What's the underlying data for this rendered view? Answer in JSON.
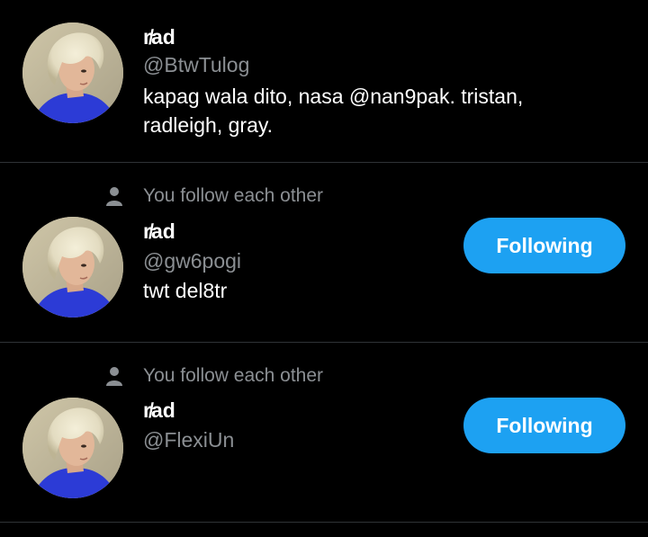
{
  "accent_color": "#1da1f2",
  "users": [
    {
      "name": "r̸ad",
      "handle": "@BtwTulog",
      "bio": "kapag wala dito, nasa @nan9pak. tristan, radleigh, gray.",
      "social_context": "",
      "button_label": ""
    },
    {
      "name": "r̸ad",
      "handle": "@gw6pogi",
      "bio": "twt del8tr",
      "social_context": "You follow each other",
      "button_label": "Following"
    },
    {
      "name": "r̸ad",
      "handle": "@FlexiUn",
      "bio": "",
      "social_context": "You follow each other",
      "button_label": "Following"
    }
  ],
  "icons": {
    "social_context": "person-icon"
  }
}
